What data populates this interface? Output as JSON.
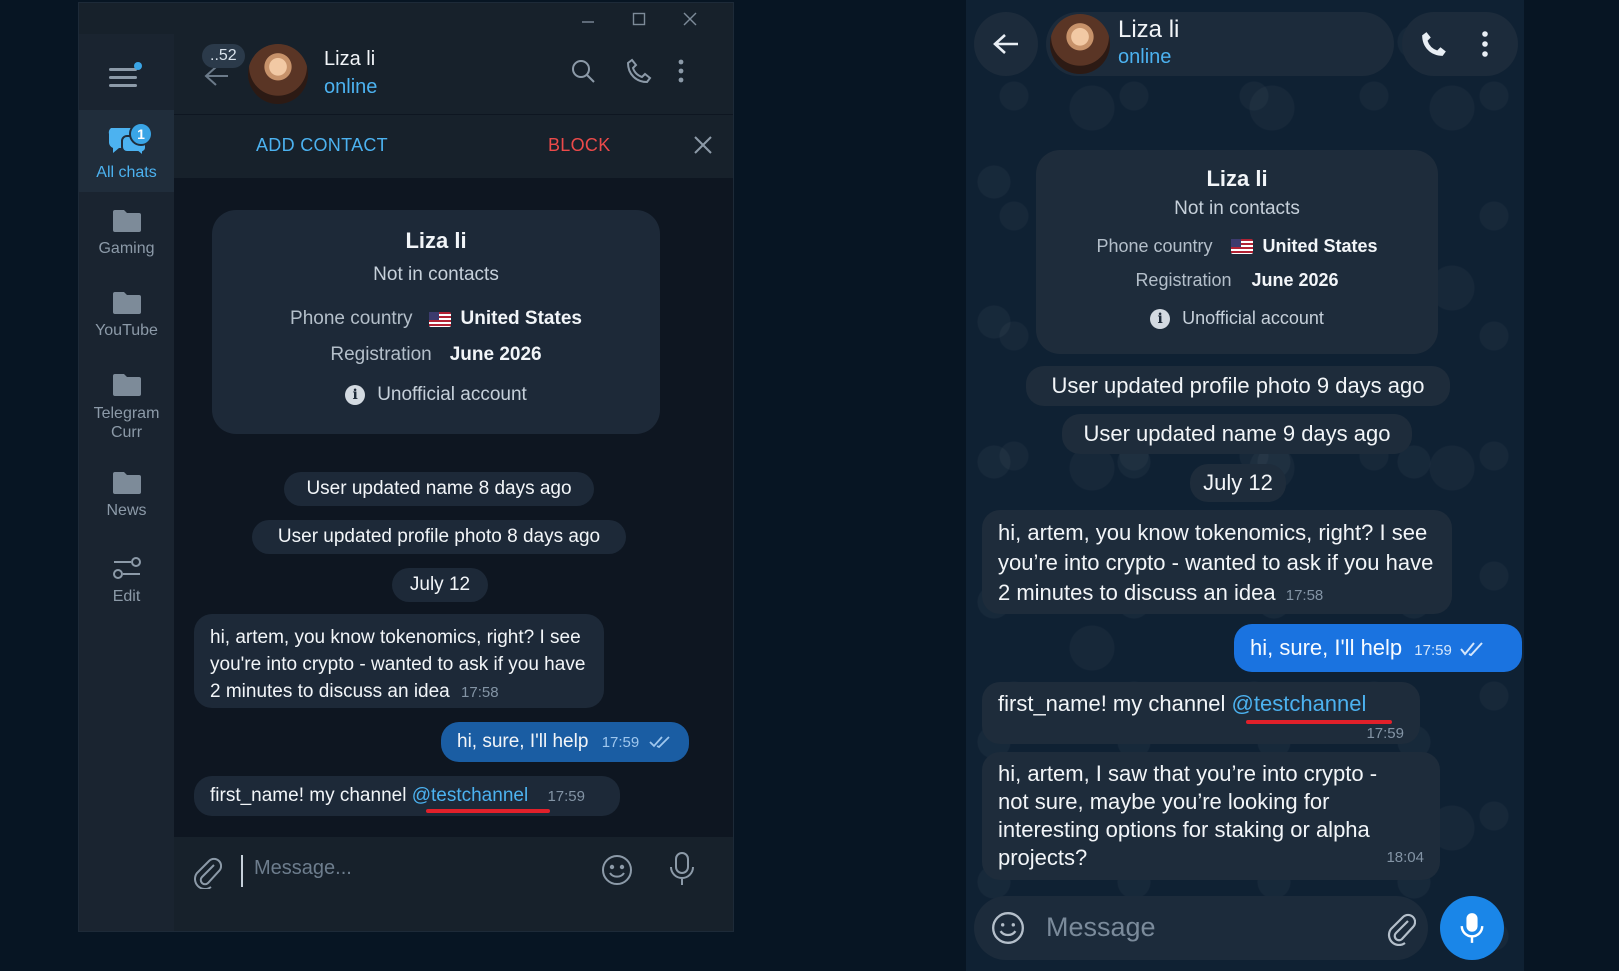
{
  "desktop": {
    "sidebar": {
      "folders": [
        {
          "label": "All chats",
          "badge": "1"
        },
        {
          "label": "Gaming"
        },
        {
          "label": "YouTube"
        },
        {
          "label": "Telegram Curr"
        },
        {
          "label": "News"
        },
        {
          "label": "Edit"
        }
      ]
    },
    "header": {
      "unread_count": "..52",
      "name": "Liza li",
      "status": "online"
    },
    "action_bar": {
      "add_contact": "ADD CONTACT",
      "block": "BLOCK"
    },
    "info_card": {
      "name": "Liza li",
      "subtitle": "Not in contacts",
      "phone_country_label": "Phone country",
      "phone_country_value": "United States",
      "registration_label": "Registration",
      "registration_value": "June 2026",
      "unofficial": "Unofficial account"
    },
    "service": {
      "name_update": "User updated name 8 days ago",
      "photo_update": "User updated profile photo 8 days ago",
      "date": "July 12"
    },
    "messages": [
      {
        "dir": "in",
        "text": "hi, artem, you know tokenomics, right? I see you're into crypto - wanted to ask if you have 2 minutes to discuss an idea",
        "time": "17:58"
      },
      {
        "dir": "out",
        "text": "hi, sure, I'll help",
        "time": "17:59"
      },
      {
        "dir": "in",
        "text_prefix": "first_name! my channel ",
        "mention": "@testchannel",
        "time": "17:59"
      }
    ],
    "composer": {
      "placeholder": "Message..."
    }
  },
  "mobile": {
    "header": {
      "name": "Liza li",
      "status": "online"
    },
    "info_card": {
      "name": "Liza li",
      "subtitle": "Not in contacts",
      "phone_country_label": "Phone country",
      "phone_country_value": "United States",
      "registration_label": "Registration",
      "registration_value": "June 2026",
      "unofficial": "Unofficial account"
    },
    "service": {
      "photo_update": "User updated profile photo 9 days ago",
      "name_update": "User updated name 9 days ago",
      "date": "July 12"
    },
    "messages": [
      {
        "dir": "in",
        "text": "hi, artem, you know tokenomics, right? I see you’re into crypto - wanted to ask if you have 2 minutes to discuss an idea",
        "time": "17:58"
      },
      {
        "dir": "out",
        "text": "hi, sure, I'll help",
        "time": "17:59"
      },
      {
        "dir": "in",
        "text_prefix": "first_name! my channel ",
        "mention": "@testchannel",
        "time": "17:59"
      },
      {
        "dir": "in",
        "text": "hi, artem, I saw that you’re into crypto - not sure, maybe you’re looking for interesting options for staking or alpha projects?",
        "time": "18:04"
      }
    ],
    "composer": {
      "placeholder": "Message"
    }
  },
  "colors": {
    "accent": "#4cb2f0",
    "block_red": "#ec4a4a",
    "outgoing_desktop": "#1a5da3",
    "outgoing_mobile": "#1a73e0",
    "mention_underline": "#e1202a"
  }
}
